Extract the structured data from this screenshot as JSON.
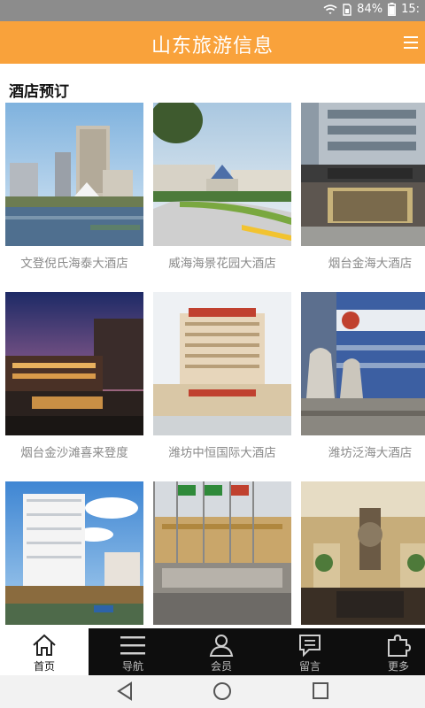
{
  "status_bar": {
    "battery": "84%",
    "time": "15:"
  },
  "header": {
    "title": "山东旅游信息"
  },
  "section": {
    "title": "酒店预订"
  },
  "hotels": [
    {
      "name": "文登倪氏海泰大酒店"
    },
    {
      "name": "威海海景花园大酒店"
    },
    {
      "name": "烟台金海大酒店"
    },
    {
      "name": "烟台金沙滩喜来登度"
    },
    {
      "name": "潍坊中恒国际大酒店"
    },
    {
      "name": "潍坊泛海大酒店"
    },
    {
      "name": ""
    },
    {
      "name": ""
    },
    {
      "name": ""
    }
  ],
  "tabs": [
    {
      "label": "首页",
      "icon": "home-icon",
      "active": true
    },
    {
      "label": "导航",
      "icon": "list-icon",
      "active": false
    },
    {
      "label": "会员",
      "icon": "user-icon",
      "active": false
    },
    {
      "label": "留言",
      "icon": "message-icon",
      "active": false
    },
    {
      "label": "更多",
      "icon": "puzzle-icon",
      "active": false
    }
  ],
  "colors": {
    "header": "#f9a23b",
    "tab_bar": "#0e0e0e",
    "caption": "#8a8a8a"
  }
}
